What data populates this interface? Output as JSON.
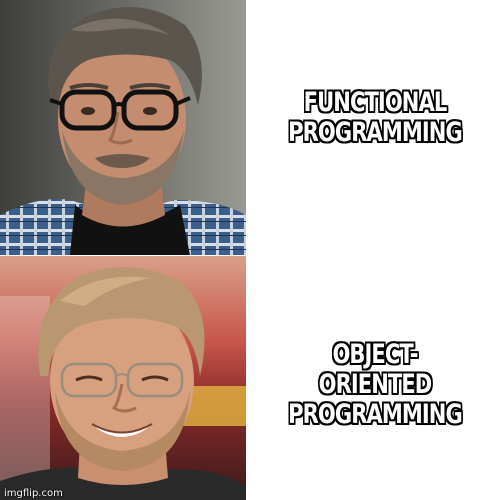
{
  "meme": {
    "top": {
      "caption_line1": "FUNCTIONAL",
      "caption_line2": "PROGRAMMING",
      "image": "man-glasses-frowning-photo"
    },
    "bottom": {
      "caption_line1": "OBJECT-ORIENTED",
      "caption_line2": "PROGRAMMING",
      "image": "man-glasses-smiling-photo"
    }
  },
  "watermark": "imgflip.com",
  "colors": {
    "caption_fill": "#ffffff",
    "caption_outline": "#000000",
    "background": "#ffffff"
  }
}
